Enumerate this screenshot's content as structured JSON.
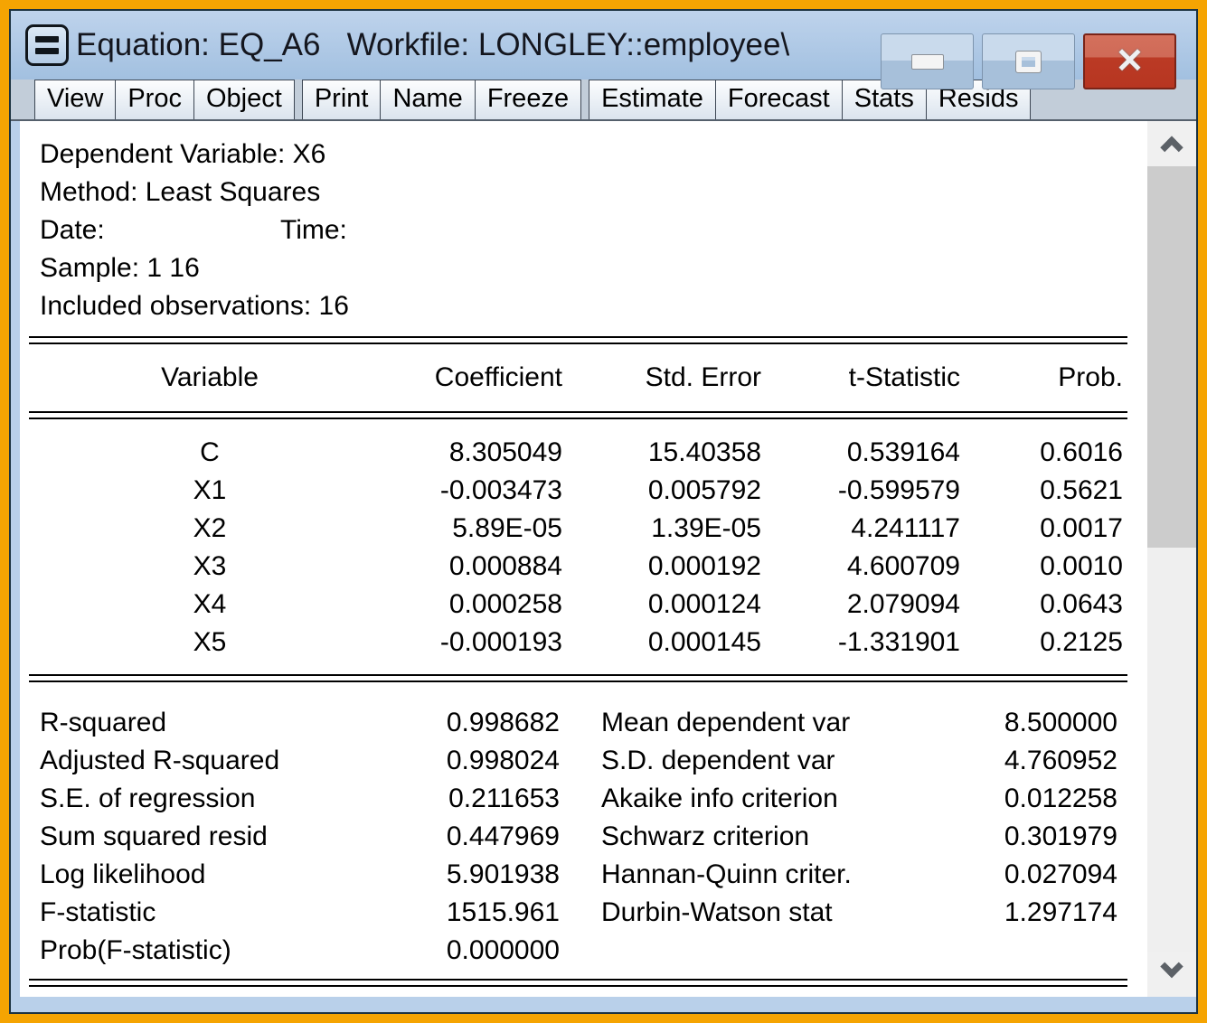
{
  "window": {
    "title": "Equation: EQ_A6   Workfile: LONGLEY::employee\\",
    "icon": "equation-object-icon",
    "controls": {
      "minimize": "minimize",
      "maximize": "maximize",
      "close": "close"
    }
  },
  "toolbar": {
    "buttons": [
      "View",
      "Proc",
      "Object",
      "Print",
      "Name",
      "Freeze",
      "Estimate",
      "Forecast",
      "Stats",
      "Resids"
    ]
  },
  "summary_header": {
    "dependent_variable": "Dependent Variable: X6",
    "method": "Method: Least Squares",
    "date_label": "Date:",
    "time_label": "Time:",
    "sample": "Sample: 1 16",
    "included_observations": "Included observations: 16"
  },
  "coef_table": {
    "headers": [
      "Variable",
      "Coefficient",
      "Std. Error",
      "t-Statistic",
      "Prob."
    ],
    "rows": [
      [
        "C",
        "8.305049",
        "15.40358",
        "0.539164",
        "0.6016"
      ],
      [
        "X1",
        "-0.003473",
        "0.005792",
        "-0.599579",
        "0.5621"
      ],
      [
        "X2",
        "5.89E-05",
        "1.39E-05",
        "4.241117",
        "0.0017"
      ],
      [
        "X3",
        "0.000884",
        "0.000192",
        "4.600709",
        "0.0010"
      ],
      [
        "X4",
        "0.000258",
        "0.000124",
        "2.079094",
        "0.0643"
      ],
      [
        "X5",
        "-0.000193",
        "0.000145",
        "-1.331901",
        "0.2125"
      ]
    ]
  },
  "stats": {
    "left": [
      {
        "label": "R-squared",
        "value": "0.998682"
      },
      {
        "label": "Adjusted R-squared",
        "value": "0.998024"
      },
      {
        "label": "S.E. of regression",
        "value": "0.211653"
      },
      {
        "label": "Sum squared resid",
        "value": "0.447969"
      },
      {
        "label": "Log likelihood",
        "value": "5.901938"
      },
      {
        "label": "F-statistic",
        "value": "1515.961"
      },
      {
        "label": "Prob(F-statistic)",
        "value": "0.000000"
      }
    ],
    "right": [
      {
        "label": "Mean dependent var",
        "value": "8.500000"
      },
      {
        "label": "S.D. dependent var",
        "value": "4.760952"
      },
      {
        "label": "Akaike info criterion",
        "value": "0.012258"
      },
      {
        "label": "Schwarz criterion",
        "value": "0.301979"
      },
      {
        "label": "Hannan-Quinn criter.",
        "value": "0.027094"
      },
      {
        "label": "Durbin-Watson stat",
        "value": "1.297174"
      }
    ]
  },
  "colors": {
    "frame_orange": "#F5A402",
    "frame_dark_line": "#1c3240",
    "titlebar_blue": "#aec8e5",
    "inner_frame_blue": "#b9d0ea",
    "close_red": "#bb3a25",
    "content_bg": "#ffffff",
    "scroll_thumb": "#cccccc",
    "scroll_track": "#efefef"
  }
}
